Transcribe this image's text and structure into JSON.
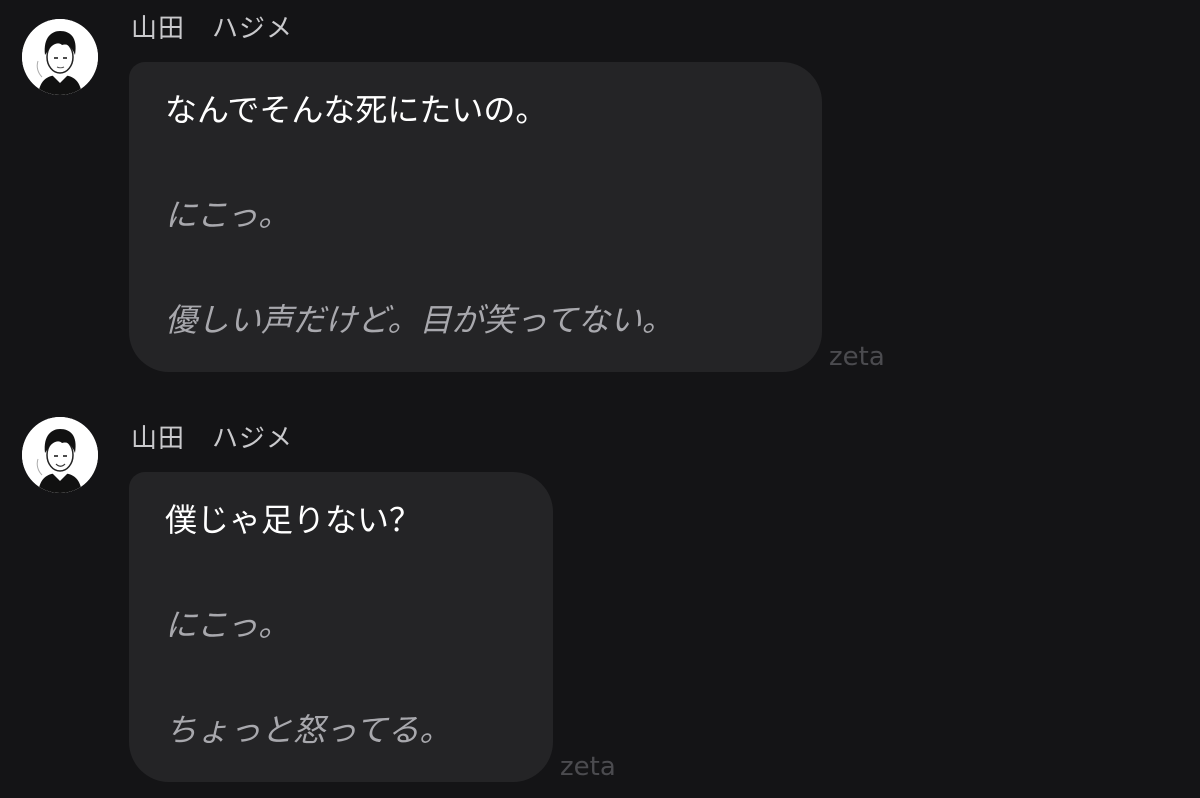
{
  "messages": [
    {
      "sender": "山田　ハジメ",
      "lines": [
        {
          "text": "なんでそんな死にたいの。",
          "kind": "speech"
        },
        {
          "text": "にこっ。",
          "kind": "narration"
        },
        {
          "text": "優しい声だけど。目が笑ってない。",
          "kind": "narration"
        }
      ],
      "watermark": "zeta"
    },
    {
      "sender": "山田　ハジメ",
      "lines": [
        {
          "text": "僕じゃ足りない？",
          "kind": "speech"
        },
        {
          "text": "にこっ。",
          "kind": "narration"
        },
        {
          "text": "ちょっと怒ってる。",
          "kind": "narration"
        }
      ],
      "watermark": "zeta"
    }
  ],
  "colors": {
    "background": "#141416",
    "bubble": "#242426",
    "speech_text": "#ffffff",
    "narration_text": "#a8a8ad",
    "sender_text": "#c9c9cc",
    "watermark_text": "#4b4b4f"
  },
  "icons": {
    "avatar": "character-portrait-icon"
  }
}
